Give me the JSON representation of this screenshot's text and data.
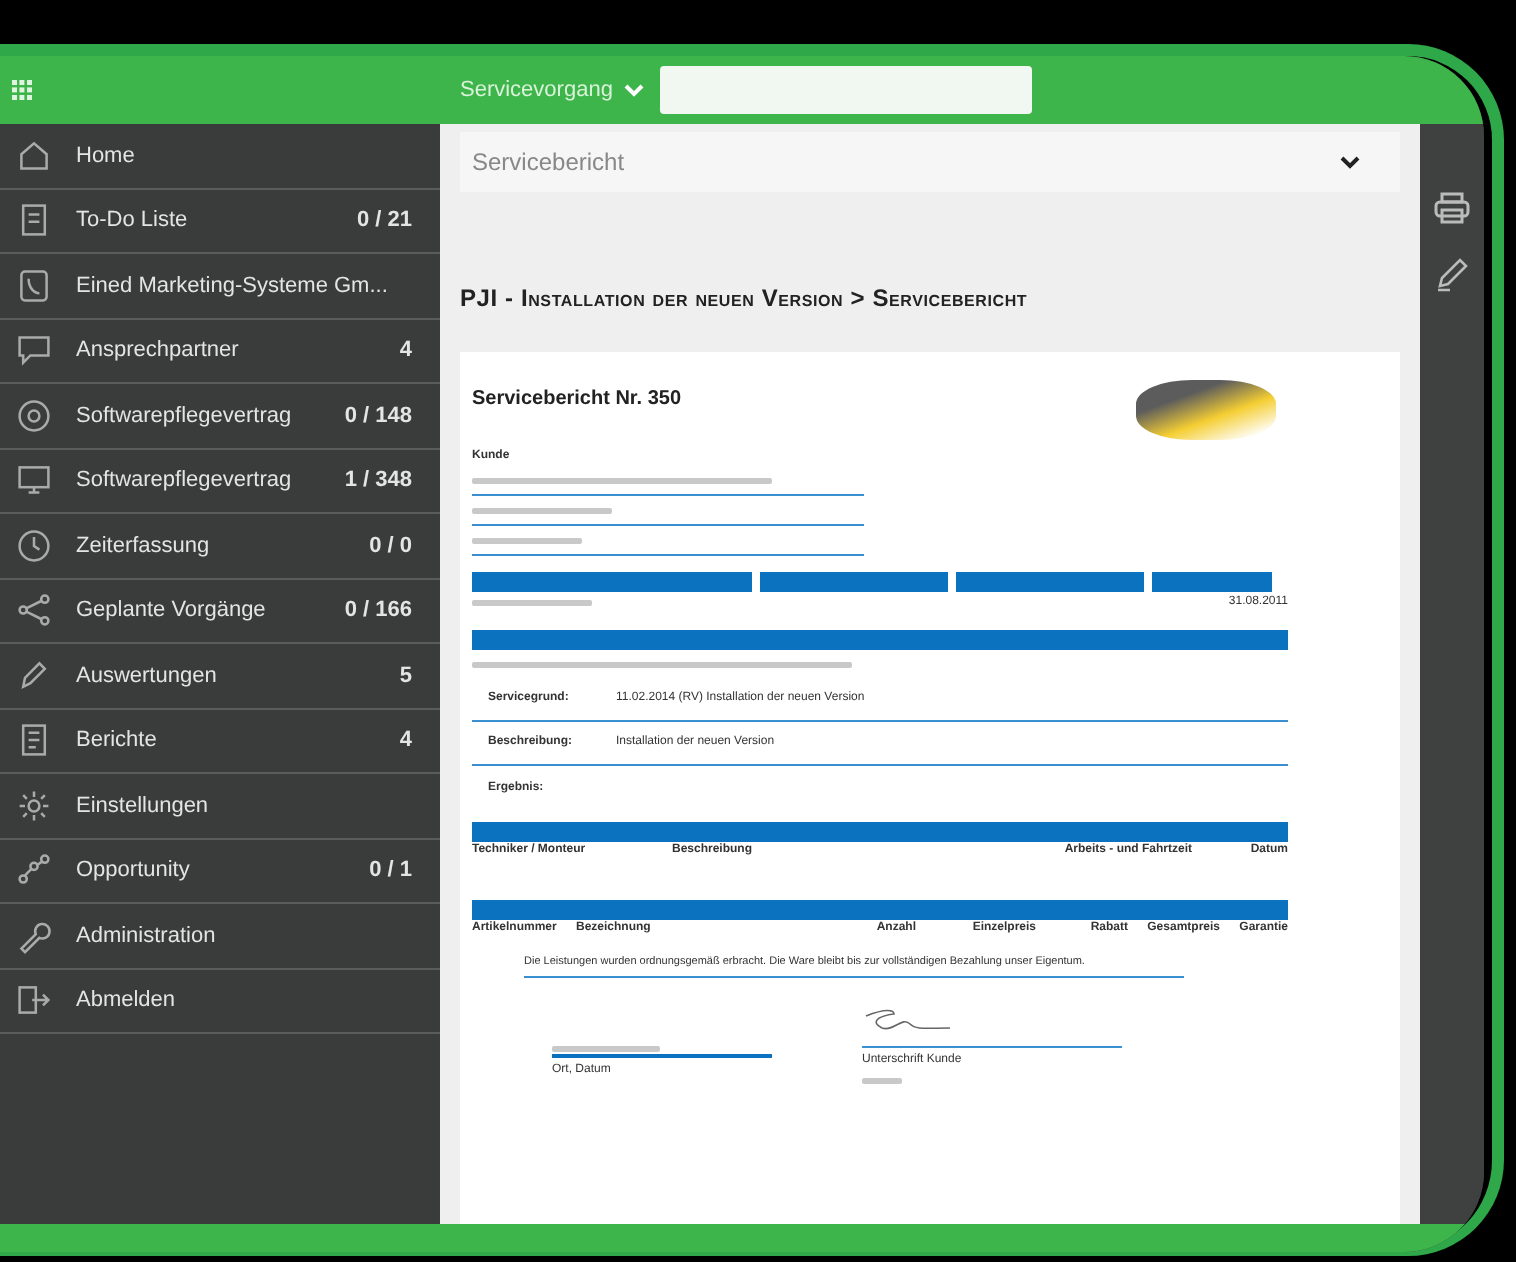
{
  "top_bar": {
    "module": "Servicevorgang"
  },
  "sidebar": {
    "items": [
      {
        "label": "Home"
      },
      {
        "label": "To-Do Liste",
        "count": "0 / 21"
      },
      {
        "label": "Eined Marketing-Systeme Gm..."
      },
      {
        "label": "Ansprechpartner",
        "count": "4"
      },
      {
        "label": "Softwarepflegevertrag",
        "count": "0 / 148"
      },
      {
        "label": "Softwarepflegevertrag",
        "count": "1 / 348"
      },
      {
        "label": "Zeiterfassung",
        "count": "0 / 0"
      },
      {
        "label": "Geplante Vorgänge",
        "count": "0 / 166"
      },
      {
        "label": "Auswertungen",
        "count": "5"
      },
      {
        "label": "Berichte",
        "count": "4"
      },
      {
        "label": "Einstellungen"
      },
      {
        "label": "Opportunity",
        "count": "0 / 1"
      },
      {
        "label": "Administration"
      },
      {
        "label": "Abmelden"
      }
    ]
  },
  "content": {
    "dropdown": "Servicebericht",
    "page_title": "PJI - Installation der neuen Version > Servicebericht",
    "report": {
      "title": "Servicebericht Nr. 350",
      "customer_label": "Kunde",
      "date_value": "31.08.2011",
      "fields": [
        {
          "label": "Servicegrund:",
          "value": "11.02.2014 (RV) Installation der neuen Version"
        },
        {
          "label": "Beschreibung:",
          "value": "Installation der neuen Version"
        },
        {
          "label": "Ergebnis:"
        }
      ],
      "work_columns": [
        "Techniker / Monteur",
        "Beschreibung",
        "Arbeits - und Fahrtzeit",
        "Datum"
      ],
      "parts_columns": [
        "Artikelnummer",
        "Bezeichnung",
        "Anzahl",
        "Einzelpreis",
        "Rabatt",
        "Gesamtpreis",
        "Garantie"
      ],
      "note": "Die Leistungen wurden ordnungsgemäß erbracht. Die Ware bleibt bis zur vollständigen Bezahlung unser Eigentum.",
      "place_date_label": "Ort, Datum",
      "signature_label": "Unterschrift Kunde"
    }
  }
}
